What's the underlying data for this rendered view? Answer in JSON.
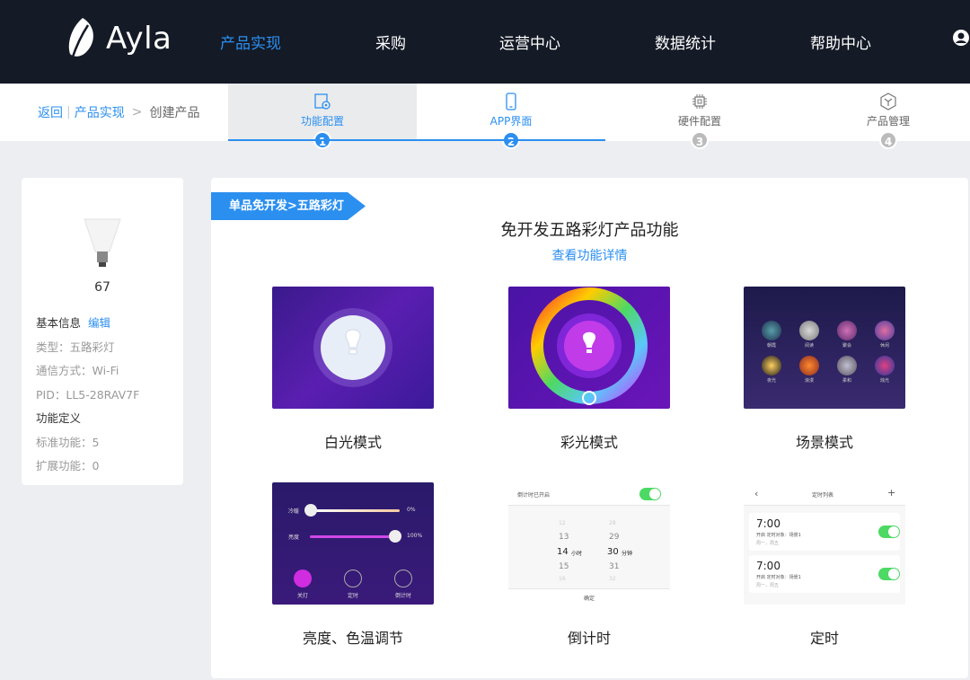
{
  "brand": {
    "name": "Ayla"
  },
  "nav": {
    "items": [
      {
        "label": "产品实现",
        "active": true
      },
      {
        "label": "采购",
        "active": false
      },
      {
        "label": "运营中心",
        "active": false
      },
      {
        "label": "数据统计",
        "active": false
      },
      {
        "label": "帮助中心",
        "active": false
      }
    ],
    "user_icon": "user-icon"
  },
  "breadcrumb": {
    "back": "返回",
    "parent": "产品实现",
    "sep": ">",
    "current": "创建产品"
  },
  "steps": [
    {
      "label": "功能配置",
      "num": "1",
      "icon": "settings-page-icon",
      "done": true
    },
    {
      "label": "APP界面",
      "num": "2",
      "icon": "phone-icon",
      "done": true
    },
    {
      "label": "硬件配置",
      "num": "3",
      "icon": "chip-icon",
      "done": false
    },
    {
      "label": "产品管理",
      "num": "4",
      "icon": "box-icon",
      "done": false
    }
  ],
  "product": {
    "count": "67",
    "basic_info": "基本信息",
    "edit": "编辑",
    "type": "类型：五路彩灯",
    "comm": "通信方式：Wi-Fi",
    "pid": "PID：LL5-28RAV7F",
    "func_def": "功能定义",
    "std_func": "标准功能：5",
    "ext_func": "扩展功能：0"
  },
  "main": {
    "ribbon": "单品免开发>五路彩灯",
    "title": "免开发五路彩灯产品功能",
    "detail_link": "查看功能详情",
    "cards": [
      {
        "label": "白光模式"
      },
      {
        "label": "彩光模式"
      },
      {
        "label": "场景模式"
      },
      {
        "label": "亮度、色温调节"
      },
      {
        "label": "倒计时"
      },
      {
        "label": "定时"
      }
    ]
  },
  "thumbs": {
    "scene_labels": [
      "朝霞",
      "阅读",
      "聚会",
      "休闲",
      "夜光",
      "浪漫",
      "柔和",
      "烛光"
    ],
    "bright": {
      "cool": "冷暖",
      "cool_val": "0%",
      "bright": "亮度",
      "bright_val": "100%",
      "btns": [
        "关灯",
        "定时",
        "倒计时"
      ]
    },
    "countdown": {
      "title": "倒计时已开启",
      "rows": [
        [
          "12",
          "28"
        ],
        [
          "13",
          "29"
        ],
        [
          "14",
          "30"
        ],
        [
          "15",
          "31"
        ],
        [
          "16",
          "32"
        ]
      ],
      "hour": "小时",
      "min": "分钟",
      "ok": "确定"
    },
    "timer": {
      "title": "定时列表",
      "items": [
        {
          "time": "7:00",
          "sub": "开启    定时对象：场景1",
          "days": "周一，周五"
        },
        {
          "time": "7:00",
          "sub": "开启    定时对象：场景1",
          "days": "周一，周五"
        }
      ]
    }
  },
  "colors": {
    "accent": "#2b8ff0",
    "nav_bg": "#141a26",
    "toggle_on": "#4cd964"
  }
}
